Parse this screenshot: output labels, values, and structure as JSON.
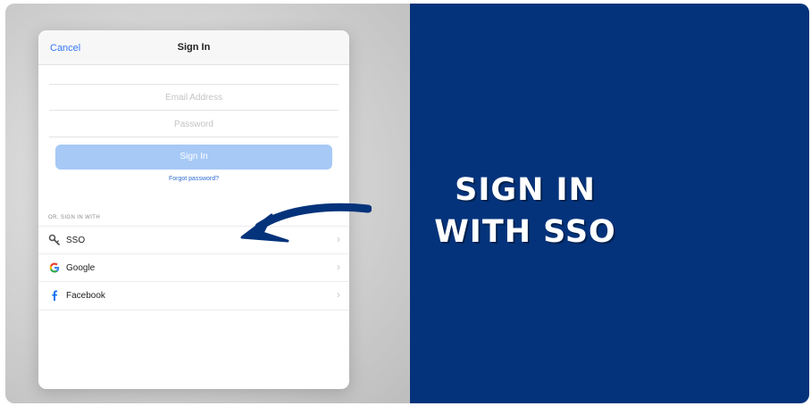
{
  "sheet": {
    "nav": {
      "cancel_label": "Cancel",
      "title": "Sign In"
    },
    "form": {
      "email_placeholder": "Email Address",
      "password_placeholder": "Password",
      "signin_label": "Sign In",
      "forgot_label": "Forgot password?"
    },
    "alt_signin": {
      "section_label": "OR, SIGN IN WITH",
      "options": [
        {
          "label": "SSO",
          "icon": "key-icon"
        },
        {
          "label": "Google",
          "icon": "google-icon"
        },
        {
          "label": "Facebook",
          "icon": "facebook-icon"
        }
      ]
    }
  },
  "callout": {
    "line1": "SIGN IN",
    "line2": "WITH SSO",
    "icon": "curved-arrow-icon"
  },
  "colors": {
    "right_panel": "#04337b",
    "button_fill": "#a7c9f6",
    "link_blue": "#3478f6",
    "arrow": "#04337b"
  }
}
